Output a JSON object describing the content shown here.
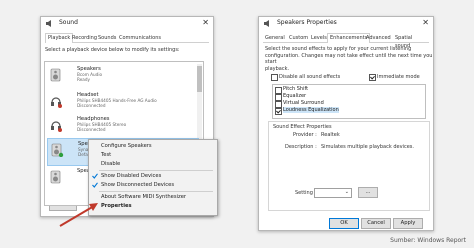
{
  "left_dialog": {
    "title": "Sound",
    "tabs": [
      "Playback",
      "Recording",
      "Sounds",
      "Communications"
    ],
    "instruction": "Select a playback device below to modify its settings:",
    "devices": [
      {
        "name": "Speakers",
        "sub": "Bcom Audio",
        "sub2": "Ready"
      },
      {
        "name": "Headset",
        "sub": "Philips SHB4405 Hands-Free AG Audio",
        "sub2": "Disconnected"
      },
      {
        "name": "Headphones",
        "sub": "Philips SHB4405 Stereo",
        "sub2": "Disconnected"
      },
      {
        "name": "Speakers",
        "sub": "Synapt",
        "sub2": "Default"
      },
      {
        "name": "Speakers",
        "sub": "",
        "sub2": ""
      }
    ],
    "configure_label": "Configure"
  },
  "context_menu": {
    "items": [
      "Configure Speakers",
      "Test",
      "Disable"
    ],
    "checks": [
      "Show Disabled Devices",
      "Show Disconnected Devices"
    ],
    "about": "About Software MIDI Synthesizer",
    "properties": "Properties"
  },
  "right_dialog": {
    "title": "Speakers Properties",
    "tabs": [
      "General",
      "Custom",
      "Levels",
      "Enhancements",
      "Advanced",
      "Spatial sound"
    ],
    "desc": [
      "Select the sound effects to apply for your current listening",
      "configuration. Changes may not take effect until the next time you start",
      "playback."
    ],
    "disable_all": "Disable all sound effects",
    "immediate": "Immediate mode",
    "effects": [
      "Pitch Shift",
      "Equalizer",
      "Virtual Surround",
      "Loudness Equalization"
    ],
    "group_title": "Sound Effect Properties",
    "provider_label": "Provider :",
    "provider_value": "Realtek",
    "description_label": "Description :",
    "description_value": "Simulates multiple playback devices.",
    "setting_label": "Setting :",
    "buttons": {
      "ok": "OK",
      "cancel": "Cancel",
      "apply": "Apply"
    }
  },
  "source": "Sumber: Windows Report",
  "colors": {
    "accent": "#0078d7",
    "selection": "#cce4f7",
    "arrow": "#c0392b"
  }
}
